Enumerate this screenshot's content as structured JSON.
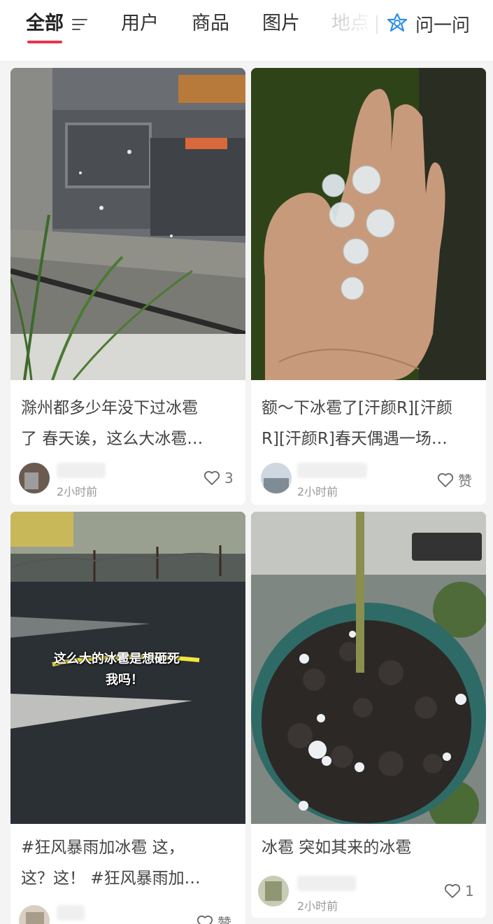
{
  "tabs": [
    {
      "label": "全部",
      "active": true
    },
    {
      "label": "用户"
    },
    {
      "label": "商品"
    },
    {
      "label": "图片"
    },
    {
      "label": "地点"
    }
  ],
  "ask": {
    "label": "问一问",
    "icon": "ask-star-icon"
  },
  "accent_color": "#e8334a",
  "cards": [
    {
      "title_lines": [
        "滁州都多少年没下过冰雹",
        "了 春天诶，这么大冰雹…"
      ],
      "time": "2小时前",
      "like_label": "3",
      "image": "hail-through-window"
    },
    {
      "title_lines": [
        "额～下冰雹了[汗颜R][汗颜",
        "R][汗颜R]春天偶遇一场…"
      ],
      "time": "2小时前",
      "like_label": "赞",
      "image": "hailstones-in-hand"
    },
    {
      "title_lines": [
        "#狂风暴雨加冰雹 这，",
        "这？这！ #狂风暴雨加…"
      ],
      "like_label": "赞",
      "overlay_text_lines": [
        "这么大的冰雹是想砸死",
        "我吗！"
      ],
      "image": "hail-on-street"
    },
    {
      "title_lines": [
        "冰雹 突如其来的冰雹"
      ],
      "time": "2小时前",
      "like_label": "1",
      "image": "hail-in-flower-pot"
    }
  ]
}
